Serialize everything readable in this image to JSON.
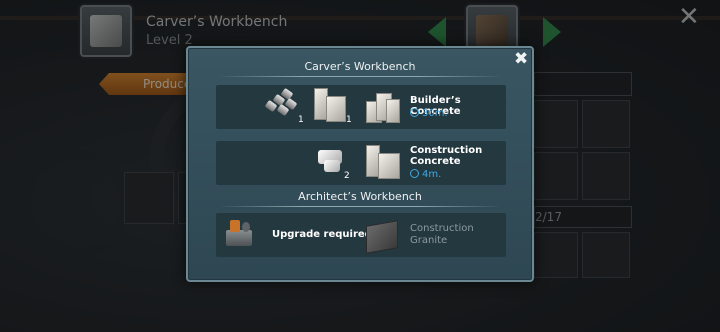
{
  "header": {
    "title": "Carver’s Workbench",
    "level": "Level 2"
  },
  "produce_tab": {
    "label": "Produce"
  },
  "bg_counter": "2/17",
  "modal": {
    "section1_title": "Carver’s Workbench",
    "section2_title": "Architect’s Workbench",
    "recipes": [
      {
        "ingredients": [
          {
            "icon": "bolts-icon",
            "qty": "1"
          },
          {
            "icon": "concrete-blocks-icon",
            "qty": "1"
          }
        ],
        "result_icon": "builders-concrete-icon",
        "result_name": "Builder’s Concrete",
        "time": "30m."
      },
      {
        "ingredients": [
          {
            "icon": "cement-chunk-icon",
            "qty": "2"
          }
        ],
        "result_icon": "construction-concrete-icon",
        "result_name_line1": "Construction",
        "result_name_line2": "Concrete",
        "time": "4m."
      },
      {
        "machine_icon": "architects-workbench-icon",
        "status": "Upgrade required!",
        "result_icon": "construction-granite-icon",
        "result_name_line1": "Construction",
        "result_name_line2": "Granite"
      }
    ]
  },
  "colors": {
    "accent_green": "#2f8f4a",
    "produce_orange": "#e08a2a",
    "time_blue": "#3fa9e2",
    "modal_bg": "#34505c"
  }
}
